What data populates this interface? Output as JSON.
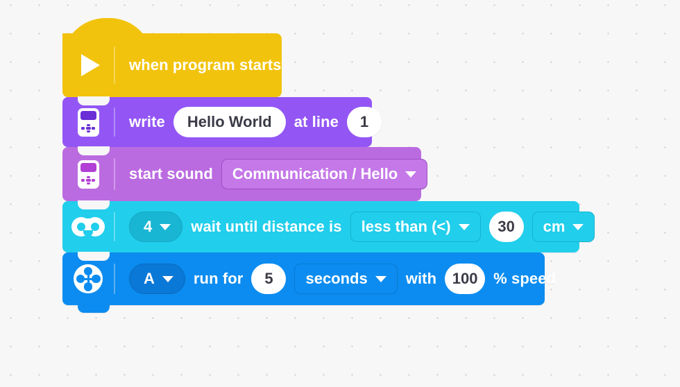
{
  "canvas": {
    "background_color": "#f7f7f8",
    "dot_color": "#d9d9de",
    "name": "block-programming-canvas"
  },
  "script": {
    "blocks": [
      {
        "id": "when-program-starts",
        "kind": "hat",
        "category": "events",
        "color": "#f2c30d",
        "icon": "play-icon",
        "label": "when program starts"
      },
      {
        "id": "write-at-line",
        "kind": "stack",
        "category": "display",
        "color": "#9356f5",
        "icon": "hub-display-icon",
        "label_before": "write",
        "text_value": "Hello World",
        "label_middle": "at line",
        "line_value": "1"
      },
      {
        "id": "start-sound",
        "kind": "stack",
        "category": "sound",
        "color": "#bb6be0",
        "icon": "hub-sound-icon",
        "label_before": "start sound",
        "sound_value": "Communication / Hello",
        "dropdown_icon": "chevron-down-icon"
      },
      {
        "id": "wait-until-distance",
        "kind": "stack",
        "category": "sensors",
        "color": "#21ceeb",
        "icon": "distance-sensor-icon",
        "port_value": "4",
        "label_before": "wait until distance is",
        "comparator_value": "less than (<)",
        "threshold_value": "30",
        "unit_value": "cm"
      },
      {
        "id": "motor-run-for",
        "kind": "stack",
        "category": "motors",
        "color": "#0c8cf0",
        "icon": "motor-icon",
        "port_value": "A",
        "label_before": "run for",
        "duration_value": "5",
        "duration_unit_value": "seconds",
        "label_with": "with",
        "speed_value": "100",
        "label_after": "% speed"
      }
    ]
  }
}
